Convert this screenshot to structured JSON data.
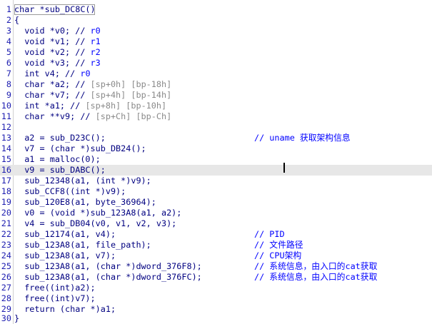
{
  "lines": [
    {
      "n": "1",
      "code": "char *sub_DC8C()",
      "comment": ""
    },
    {
      "n": "2",
      "code": "{",
      "comment": ""
    },
    {
      "n": "3",
      "code": "  void *v0; // ",
      "comment": "r0"
    },
    {
      "n": "4",
      "code": "  void *v1; // ",
      "comment": "r1"
    },
    {
      "n": "5",
      "code": "  void *v2; // ",
      "comment": "r2"
    },
    {
      "n": "6",
      "code": "  void *v3; // ",
      "comment": "r3"
    },
    {
      "n": "7",
      "code": "  int v4; // ",
      "comment": "r0"
    },
    {
      "n": "8",
      "code": "  char *a2; // ",
      "comment": "[sp+0h] [bp-18h]"
    },
    {
      "n": "9",
      "code": "  char *v7; // ",
      "comment": "[sp+4h] [bp-14h]"
    },
    {
      "n": "10",
      "code": "  int *a1; // ",
      "comment": "[sp+8h] [bp-10h]"
    },
    {
      "n": "11",
      "code": "  char **v9; // ",
      "comment": "[sp+Ch] [bp-Ch]"
    },
    {
      "n": "12",
      "code": "",
      "comment": ""
    },
    {
      "n": "13",
      "code": "  a2 = sub_D23C();",
      "comment": "// uname 获取架构信息"
    },
    {
      "n": "14",
      "code": "  v7 = (char *)sub_DB24();",
      "comment": ""
    },
    {
      "n": "15",
      "code": "  a1 = malloc(0);",
      "comment": ""
    },
    {
      "n": "16",
      "code": "  v9 = sub_DABC();",
      "comment": ""
    },
    {
      "n": "17",
      "code": "  sub_12348(a1, (int *)v9);",
      "comment": ""
    },
    {
      "n": "18",
      "code": "  sub_CCF8((int *)v9);",
      "comment": ""
    },
    {
      "n": "19",
      "code": "  sub_120E8(a1, byte_36964);",
      "comment": ""
    },
    {
      "n": "20",
      "code": "  v0 = (void *)sub_123A8(a1, a2);",
      "comment": ""
    },
    {
      "n": "21",
      "code": "  v4 = sub_DB04(v0, v1, v2, v3);",
      "comment": ""
    },
    {
      "n": "22",
      "code": "  sub_12174(a1, v4);",
      "comment": "// PID"
    },
    {
      "n": "23",
      "code": "  sub_123A8(a1, file_path);",
      "comment": "// 文件路径"
    },
    {
      "n": "24",
      "code": "  sub_123A8(a1, v7);",
      "comment": "// CPU架构"
    },
    {
      "n": "25",
      "code": "  sub_123A8(a1, (char *)dword_376F8);",
      "comment": "// 系统信息，由入口的cat获取"
    },
    {
      "n": "26",
      "code": "  sub_123A8(a1, (char *)dword_376FC);",
      "comment": "// 系统信息，由入口的cat获取"
    },
    {
      "n": "27",
      "code": "  free((int)a2);",
      "comment": ""
    },
    {
      "n": "28",
      "code": "  free((int)v7);",
      "comment": ""
    },
    {
      "n": "29",
      "code": "  return (char *)a1;",
      "comment": ""
    },
    {
      "n": "30",
      "code": "}",
      "comment": ""
    }
  ],
  "colors": {
    "keyword": "#000080",
    "comment": "#0000ff",
    "dim_comment": "#8a8a8a",
    "highlight": "#e7e7e7"
  }
}
